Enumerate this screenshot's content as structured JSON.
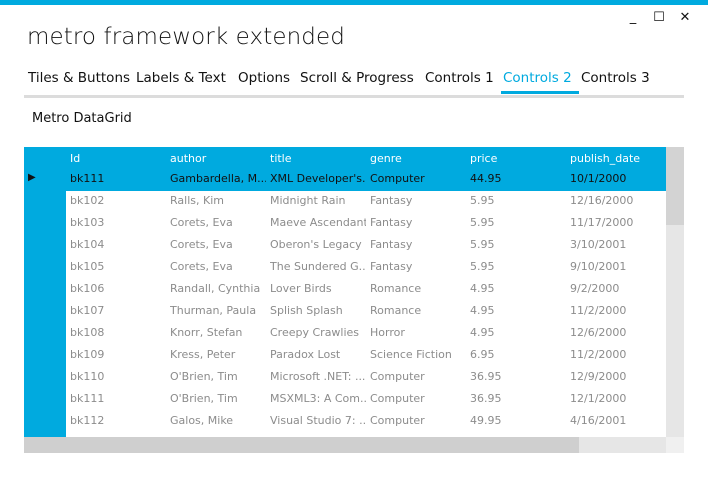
{
  "window": {
    "title": "metro framework extended",
    "controls": [
      "_",
      "☐",
      "✕"
    ]
  },
  "tabs": [
    {
      "label": "Tiles & Buttons",
      "active": false
    },
    {
      "label": "Labels & Text",
      "active": false
    },
    {
      "label": "Options",
      "active": false
    },
    {
      "label": "Scroll & Progress",
      "active": false
    },
    {
      "label": "Controls 1",
      "active": false
    },
    {
      "label": "Controls 2",
      "active": true
    },
    {
      "label": "Controls 3",
      "active": false
    }
  ],
  "section_label": "Metro DataGrid",
  "grid": {
    "columns": [
      "Id",
      "author",
      "title",
      "genre",
      "price",
      "publish_date"
    ],
    "selected_row_index": 0,
    "rows": [
      [
        "bk111",
        "Gambardella, M...",
        "XML Developer's...",
        "Computer",
        "44.95",
        "10/1/2000"
      ],
      [
        "bk102",
        "Ralls, Kim",
        "Midnight Rain",
        "Fantasy",
        "5.95",
        "12/16/2000"
      ],
      [
        "bk103",
        "Corets, Eva",
        "Maeve Ascendant",
        "Fantasy",
        "5.95",
        "11/17/2000"
      ],
      [
        "bk104",
        "Corets, Eva",
        "Oberon's Legacy",
        "Fantasy",
        "5.95",
        "3/10/2001"
      ],
      [
        "bk105",
        "Corets, Eva",
        "The Sundered G...",
        "Fantasy",
        "5.95",
        "9/10/2001"
      ],
      [
        "bk106",
        "Randall, Cynthia",
        "Lover Birds",
        "Romance",
        "4.95",
        "9/2/2000"
      ],
      [
        "bk107",
        "Thurman, Paula",
        "Splish Splash",
        "Romance",
        "4.95",
        "11/2/2000"
      ],
      [
        "bk108",
        "Knorr, Stefan",
        "Creepy Crawlies",
        "Horror",
        "4.95",
        "12/6/2000"
      ],
      [
        "bk109",
        "Kress, Peter",
        "Paradox Lost",
        "Science Fiction",
        "6.95",
        "11/2/2000"
      ],
      [
        "bk110",
        "O'Brien, Tim",
        "Microsoft .NET: ...",
        "Computer",
        "36.95",
        "12/9/2000"
      ],
      [
        "bk111",
        "O'Brien, Tim",
        "MSXML3: A Com...",
        "Computer",
        "36.95",
        "12/1/2000"
      ],
      [
        "bk112",
        "Galos, Mike",
        "Visual Studio 7: ...",
        "Computer",
        "49.95",
        "4/16/2001"
      ]
    ]
  },
  "colors": {
    "accent": "#00aadf",
    "muted_text": "#8c8c8c"
  }
}
